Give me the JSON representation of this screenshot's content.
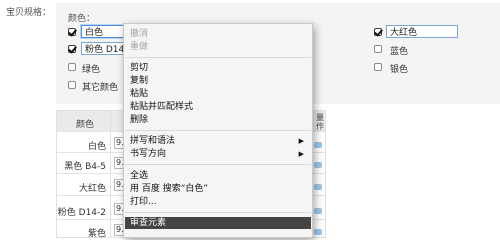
{
  "spec": {
    "label": "宝贝规格：",
    "section_title": "颜色："
  },
  "colors": [
    {
      "name": "白色",
      "checked": true,
      "editing": true
    },
    {
      "name": "粉色 D14-2",
      "checked": true,
      "editing": true
    },
    {
      "name": "大红色",
      "checked": true,
      "editing": true
    },
    {
      "name": "蓝色",
      "checked": false
    },
    {
      "name": "绿色",
      "checked": false
    },
    {
      "name": "银色",
      "checked": false
    },
    {
      "name": "其它颜色",
      "checked": false
    }
  ],
  "table": {
    "header_color": "颜色",
    "header_batch": "批量操作",
    "header_batch_line1": "量",
    "header_batch_line2": "作",
    "rows": [
      {
        "color": "白色",
        "price": "9."
      },
      {
        "color": "黑色 B4-5",
        "price": "9."
      },
      {
        "color": "大红色",
        "price": "9."
      },
      {
        "color": "粉色 D14-2",
        "price": "9."
      },
      {
        "color": "紫色",
        "price": "9."
      }
    ]
  },
  "context_menu": {
    "undo": "撤消",
    "redo": "重做",
    "cut": "剪切",
    "copy": "复制",
    "paste": "粘贴",
    "paste_match": "粘贴并匹配样式",
    "delete": "删除",
    "spelling": "拼写和语法",
    "writing_direction": "书写方向",
    "select_all": "全选",
    "search": "用 百度 搜索“白色”",
    "print": "打印...",
    "inspect": "审查元素",
    "submenu_arrow": "▶"
  },
  "colors_hex": {
    "menu_hover": "#444444",
    "input_border": "#7aa7d8",
    "panel_bg": "#f4f4f4"
  }
}
